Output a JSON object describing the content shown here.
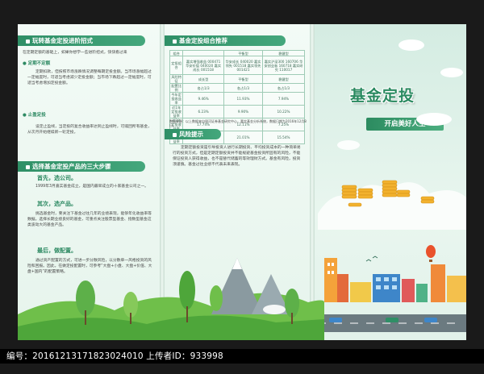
{
  "panel1": {
    "section1_title": "玩转基金定投进阶招式",
    "intro": "在定期定额的基础上，如果你想学一些进阶招式，快快看过来",
    "tip1_title": "● 定期不定额",
    "tip1_text": "定期扣款，但按照市场涨跌情况调整每期定投金额。当市场涨幅超过一定幅度时，可适当考虑减少定投金额；当市场下跌超过一定幅度时，可适当考虑增加定投金额。",
    "tip2_title": "● 止盈定投",
    "tip2_text": "设定止盈线，当定投的复合收益率达到止盈线时，可赎回所有基金，从次月开始继续新一轮定投。",
    "section2_title": "选择基金定投产品的三大步骤",
    "step1_label": "首先，选公司。",
    "step1_text": "1999年3月嘉实基金成立，是国内最早成立的十家基金公司之一。",
    "step2_label": "其次，选产品。",
    "step2_text": "挑选基金时，要关注下基金过往几年的业绩表现，能够年化收益率等数据。选择长期业绩良好的基金，可重点关注股票型基金、指数型基金这类波动大的基金产品。",
    "step3_label": "最后，做配置。",
    "step3_text": "通过资产配置的方式，可进一步分散风险，以分散单一风格投资的风险和回报。因此，在做定投配置时，可参考“大盘+小盘、大盘+价值、大盘+国内”的配置策略。"
  },
  "panel2": {
    "section1_title": "基金定投组合推荐",
    "table_header": [
      "组合",
      "",
      "平衡型",
      "稳健型"
    ],
    "table_rows": [
      [
        "定投组合",
        "嘉实增强收益 000471 华安价值 040020 嘉实成长 001518",
        "华安成长 040020 嘉实领先 001518 嘉实领先 001421",
        "嘉实沪深300 160706 华安创业板 160718 嘉实研究 110017"
      ],
      [
        "风险特征",
        "成长型",
        "平衡型",
        "稳健型"
      ],
      [
        "配置比例",
        "各占1/3",
        "各占1/3",
        "各占1/3"
      ],
      [
        "今年定投收益率",
        "9.46%",
        "11.93%",
        "7.94%"
      ],
      [
        "近1年定投收益率",
        "6.23%",
        "9.90%",
        "10.22%"
      ],
      [
        "近2年定投收益率",
        "17.74%",
        "12.11%",
        "7.25%"
      ],
      [
        "近3年定投收益率",
        "16.72%",
        "21.01%",
        "15.54%"
      ]
    ],
    "note": "数据来源：以上数据来自银河证券基金研究中心，嘉实基金分析系统，数据日期为2016年12月8日。",
    "section2_title": "风险提示",
    "risk_text": "定期定额投资是引导投资人进行长期投资、平均投资成本的一种简单易行的投资方式，但是定期定额投资并不能规避基金投资所固有的风险，不能保证投资人获得收益，也不是替代储蓄的等效理财方式。基金有风险，投资须谨慎。基金过往业绩不代表未来表现。"
  },
  "panel3": {
    "title": "基金定投",
    "subtitle": "开启美好人生"
  },
  "footer": {
    "text": "编号：20161213171823024010  上传者ID：933998"
  },
  "colors": {
    "primary_green": "#2f8f66",
    "background": "#e8f5ee"
  }
}
